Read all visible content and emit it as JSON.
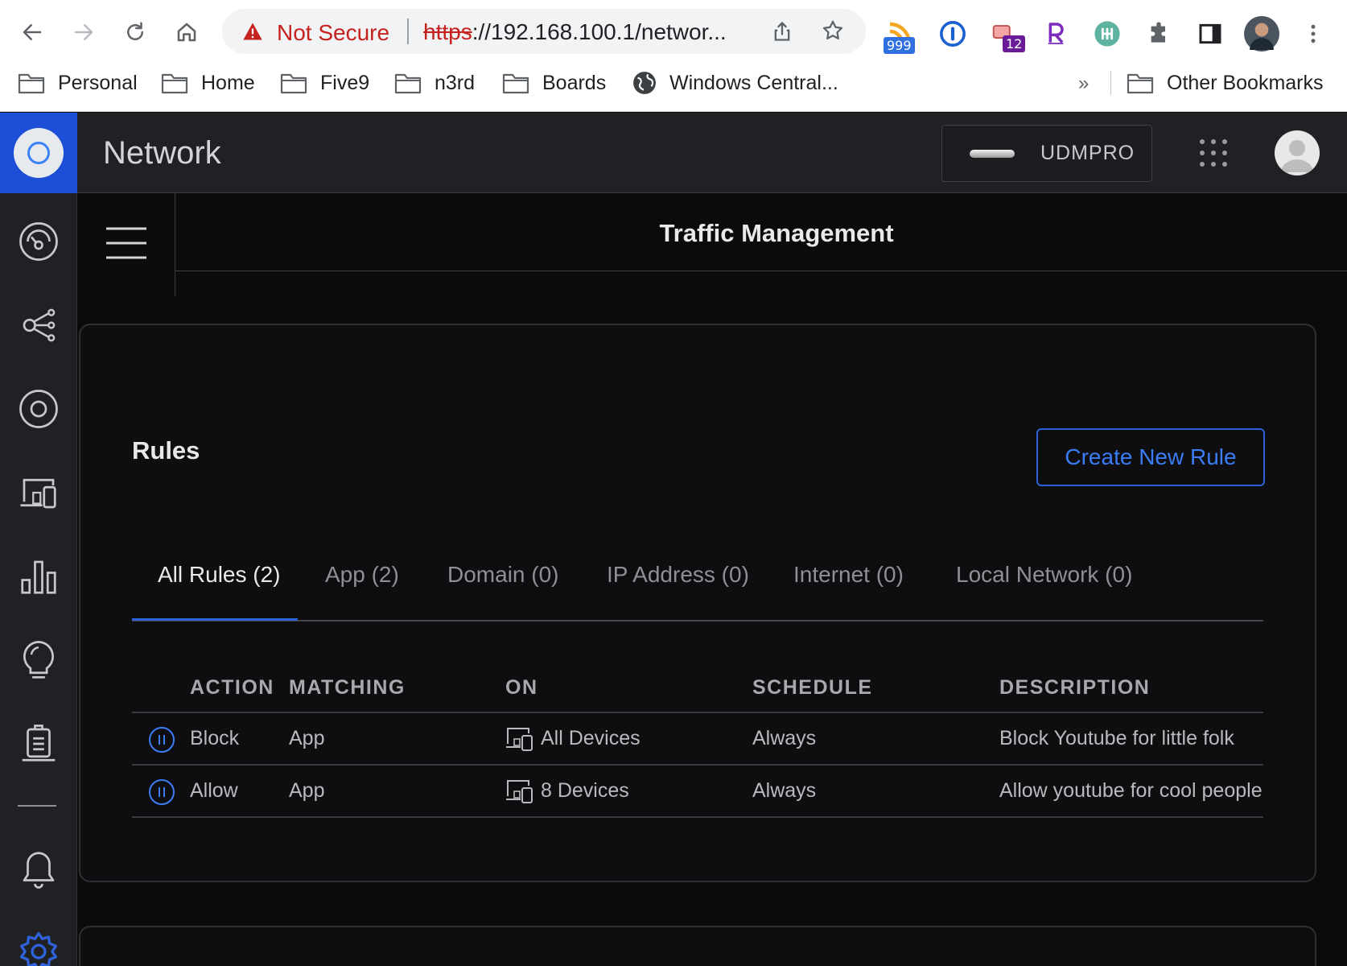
{
  "browser": {
    "omnibox": {
      "security_label": "Not Secure",
      "url_scheme": "https",
      "url_rest": "://192.168.100.1/networ..."
    },
    "extensions": [
      {
        "icon": "rss-icon",
        "badge": "999"
      },
      {
        "icon": "password-manager-icon",
        "badge": ""
      },
      {
        "icon": "extension-icon",
        "badge": "12"
      },
      {
        "icon": "r-extension-icon",
        "badge": ""
      },
      {
        "icon": "green-extension-icon",
        "badge": ""
      },
      {
        "icon": "puzzle-icon",
        "badge": ""
      },
      {
        "icon": "side-panel-icon",
        "badge": ""
      },
      {
        "icon": "profile-avatar",
        "badge": ""
      },
      {
        "icon": "kebab-menu-icon",
        "badge": ""
      }
    ],
    "bookmarks": [
      {
        "label": "Personal",
        "icon": "folder-icon"
      },
      {
        "label": "Home",
        "icon": "folder-icon"
      },
      {
        "label": "Five9",
        "icon": "folder-icon"
      },
      {
        "label": "n3rd",
        "icon": "folder-icon"
      },
      {
        "label": "Boards",
        "icon": "folder-icon"
      },
      {
        "label": "Windows Central...",
        "icon": "globe-icon"
      }
    ],
    "bookmarks_overflow": "»",
    "other_bookmarks": "Other Bookmarks"
  },
  "app": {
    "title": "Network",
    "device_name": "UDMPRO",
    "accent_color": "#2f62d9"
  },
  "nav": [
    {
      "name": "dashboard-icon"
    },
    {
      "name": "topology-icon"
    },
    {
      "name": "unifi-devices-icon"
    },
    {
      "name": "client-devices-icon"
    },
    {
      "name": "statistics-icon"
    },
    {
      "name": "insights-icon"
    },
    {
      "name": "system-log-icon"
    },
    {
      "name": "notifications-icon"
    },
    {
      "name": "settings-icon"
    }
  ],
  "page": {
    "title": "Traffic Management"
  },
  "rules": {
    "title": "Rules",
    "create_button": "Create New Rule",
    "tabs": [
      {
        "label": "All Rules (2)",
        "active": true
      },
      {
        "label": "App (2)",
        "active": false
      },
      {
        "label": "Domain (0)",
        "active": false
      },
      {
        "label": "IP Address (0)",
        "active": false
      },
      {
        "label": "Internet (0)",
        "active": false
      },
      {
        "label": "Local Network (0)",
        "active": false
      }
    ],
    "columns": {
      "action": "ACTION",
      "matching": "MATCHING",
      "on": "ON",
      "schedule": "SCHEDULE",
      "description": "DESCRIPTION"
    },
    "rows": [
      {
        "action": "Block",
        "matching": "App",
        "on": "All Devices",
        "schedule": "Always",
        "description": "Block Youtube for little folk"
      },
      {
        "action": "Allow",
        "matching": "App",
        "on": "8 Devices",
        "schedule": "Always",
        "description": "Allow youtube for cool people"
      }
    ]
  }
}
